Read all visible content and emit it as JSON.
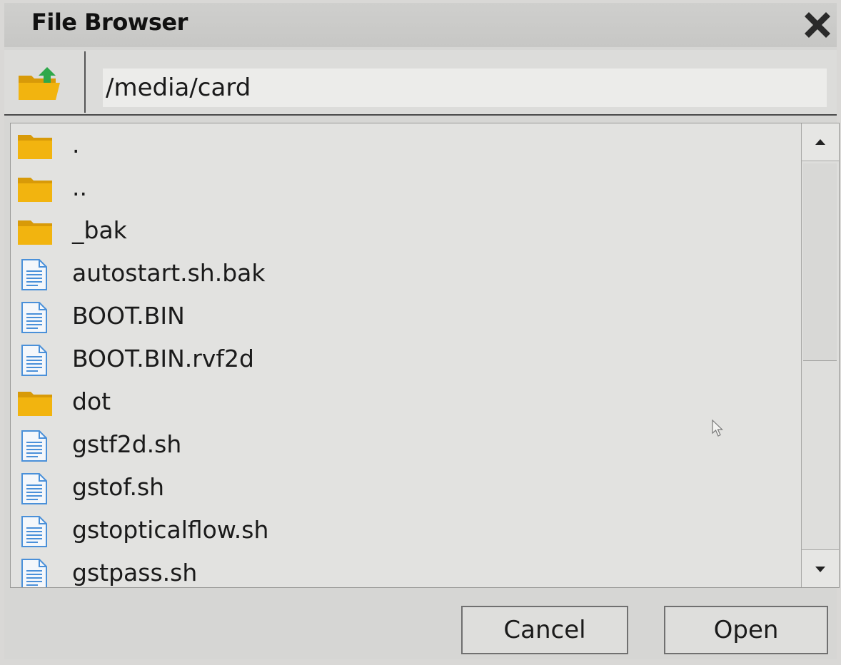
{
  "window": {
    "title": "File Browser",
    "close_icon": "close-icon"
  },
  "pathbar": {
    "up_icon": "folder-up-icon",
    "path": "/media/card"
  },
  "files": [
    {
      "name": ".",
      "type": "folder",
      "icon": "folder-icon"
    },
    {
      "name": "..",
      "type": "folder",
      "icon": "folder-icon"
    },
    {
      "name": "_bak",
      "type": "folder",
      "icon": "folder-icon"
    },
    {
      "name": "autostart.sh.bak",
      "type": "file",
      "icon": "file-icon"
    },
    {
      "name": "BOOT.BIN",
      "type": "file",
      "icon": "file-icon"
    },
    {
      "name": "BOOT.BIN.rvf2d",
      "type": "file",
      "icon": "file-icon"
    },
    {
      "name": "dot",
      "type": "folder",
      "icon": "folder-icon"
    },
    {
      "name": "gstf2d.sh",
      "type": "file",
      "icon": "file-icon"
    },
    {
      "name": "gstof.sh",
      "type": "file",
      "icon": "file-icon"
    },
    {
      "name": "gstopticalflow.sh",
      "type": "file",
      "icon": "file-icon"
    },
    {
      "name": "gstpass.sh",
      "type": "file",
      "icon": "file-icon"
    }
  ],
  "scrollbar": {
    "up_icon": "arrow-up-icon",
    "down_icon": "arrow-down-icon"
  },
  "buttons": {
    "cancel_label": "Cancel",
    "open_label": "Open"
  },
  "colors": {
    "folder": "#f2b40f",
    "folder_dark": "#d89a08",
    "file_outline": "#4a90d9",
    "up_arrow": "#2ea84a"
  }
}
